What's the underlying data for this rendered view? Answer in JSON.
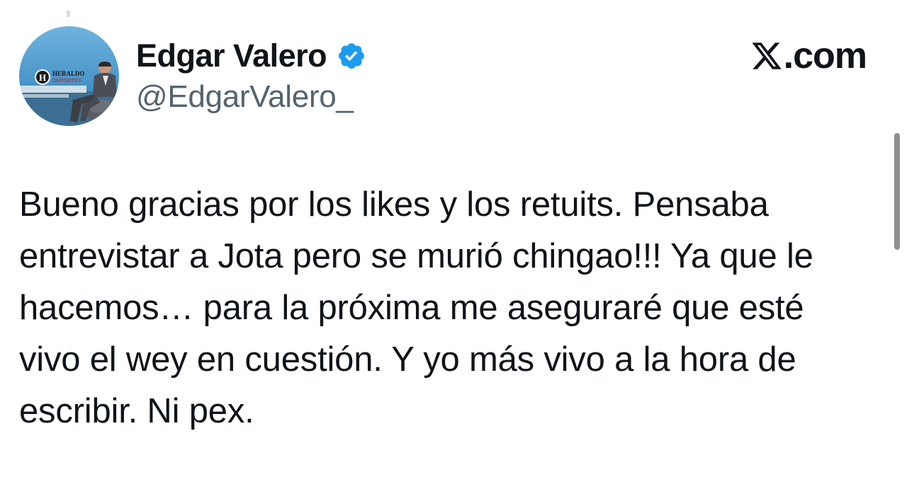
{
  "author": {
    "display_name": "Edgar Valero",
    "handle": "@EdgarValero_",
    "verified_icon": "verified-badge-icon",
    "avatar_logo_text": [
      "HERALDO",
      "DEPORTES"
    ],
    "avatar_logo_letter": "H"
  },
  "brand": {
    "icon": "x-logo-icon",
    "suffix": ".com"
  },
  "tweet": {
    "lines": [
      "Bueno gracias por los likes y los retuits. Pensaba",
      "entrevistar a Jota pero se murió chingao!!! Ya que le",
      "hacemos… para la próxima me aseguraré que esté",
      "vivo el wey en cuestión. Y yo más vivo a la hora de",
      "escribir. Ni pex."
    ]
  },
  "colors": {
    "text_primary": "#0f1419",
    "text_secondary": "#536471",
    "verified_blue": "#1d9bf0",
    "background": "#ffffff"
  }
}
